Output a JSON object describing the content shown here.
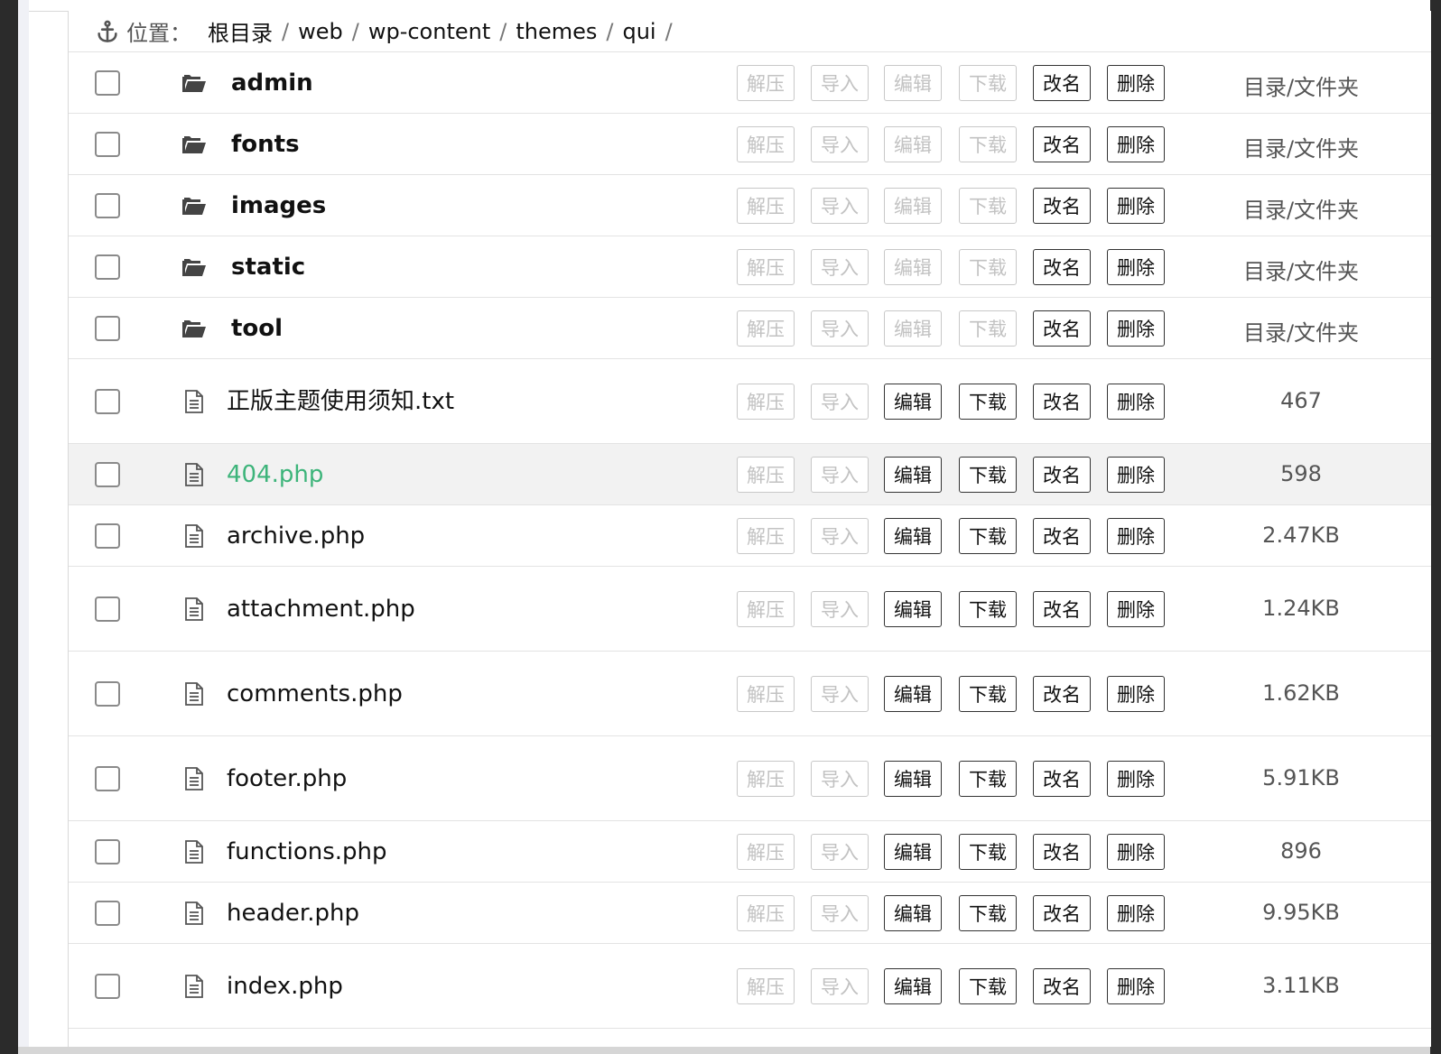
{
  "breadcrumb": {
    "label": "位置：",
    "segments": [
      "根目录",
      "web",
      "wp-content",
      "themes",
      "qui"
    ],
    "separator": "/"
  },
  "icons": {
    "anchor": "anchor-icon",
    "folder": "folder-open-icon",
    "file": "file-text-icon"
  },
  "actions": [
    "解压",
    "导入",
    "编辑",
    "下载",
    "改名",
    "删除"
  ],
  "entries": [
    {
      "name": "admin",
      "type": "dir",
      "meta": "目录/文件夹"
    },
    {
      "name": "fonts",
      "type": "dir",
      "meta": "目录/文件夹"
    },
    {
      "name": "images",
      "type": "dir",
      "meta": "目录/文件夹"
    },
    {
      "name": "static",
      "type": "dir",
      "meta": "目录/文件夹"
    },
    {
      "name": "tool",
      "type": "dir",
      "meta": "目录/文件夹"
    },
    {
      "name": "正版主题使用须知.txt",
      "type": "file",
      "meta": "467"
    },
    {
      "name": "404.php",
      "type": "file",
      "meta": "598",
      "active": true
    },
    {
      "name": "archive.php",
      "type": "file",
      "meta": "2.47KB"
    },
    {
      "name": "attachment.php",
      "type": "file",
      "meta": "1.24KB"
    },
    {
      "name": "comments.php",
      "type": "file",
      "meta": "1.62KB"
    },
    {
      "name": "footer.php",
      "type": "file",
      "meta": "5.91KB"
    },
    {
      "name": "functions.php",
      "type": "file",
      "meta": "896"
    },
    {
      "name": "header.php",
      "type": "file",
      "meta": "9.95KB"
    },
    {
      "name": "index.php",
      "type": "file",
      "meta": "3.11KB"
    }
  ],
  "colors": {
    "active_link": "#3db47a",
    "disabled_text": "#c2c2c2",
    "row_highlight": "#f2f2f2"
  }
}
